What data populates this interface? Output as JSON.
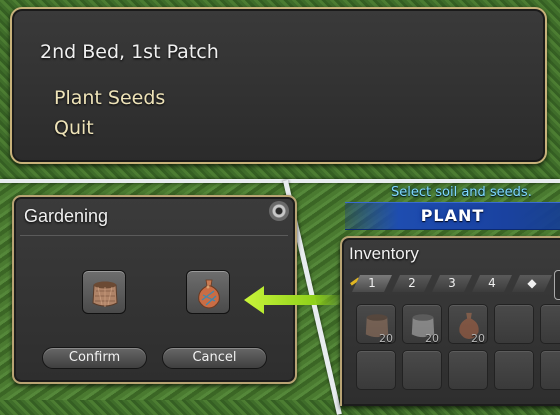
{
  "dialog": {
    "title": "2nd Bed, 1st Patch",
    "options": [
      "Plant Seeds",
      "Quit"
    ]
  },
  "gardening": {
    "title": "Gardening",
    "settings_icon": "gear-icon",
    "slots": [
      {
        "item": "soil-bag-icon"
      },
      {
        "item": "seed-bag-icon"
      }
    ],
    "confirm_label": "Confirm",
    "cancel_label": "Cancel"
  },
  "hint": {
    "text": "Select soil and seeds.",
    "banner": "PLANT"
  },
  "inventory": {
    "title": "Inventory",
    "tabs": [
      "1",
      "2",
      "3",
      "4"
    ],
    "items": [
      {
        "icon": "soil-bag-icon",
        "qty": "20"
      },
      {
        "icon": "soil-bag-icon",
        "qty": "20"
      },
      {
        "icon": "seed-bag-icon",
        "qty": "20"
      }
    ]
  },
  "colors": {
    "frame_gold": "#c8b27a",
    "option_text": "#eee3b8",
    "hint_cyan": "#7fd8ff",
    "banner_blue": "#1e4db0",
    "arrow_green": "#8fd11a"
  }
}
